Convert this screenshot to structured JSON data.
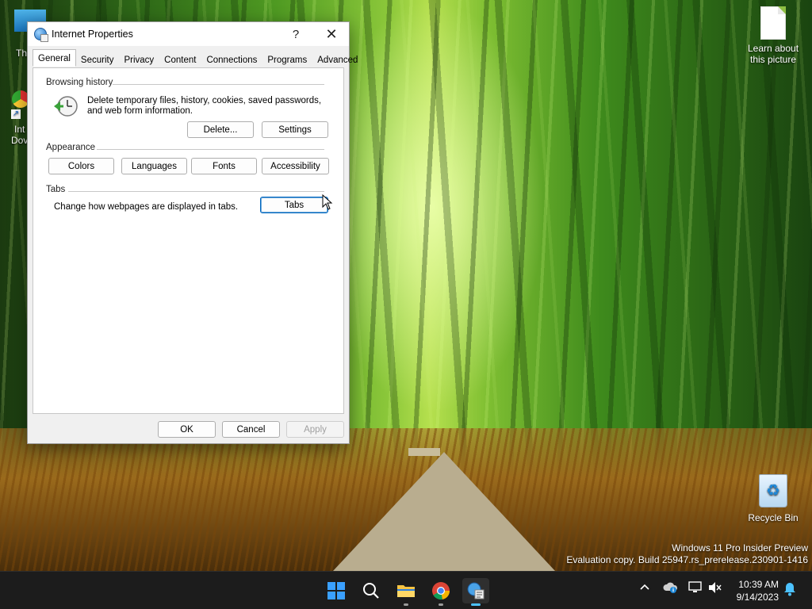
{
  "desktop": {
    "icons": {
      "learn_label": "Learn about this picture",
      "recycle_label": "Recycle Bin",
      "left_top_label": "Th",
      "left_mid_label_1": "Int",
      "left_mid_label_2": "Dov"
    },
    "watermark": {
      "line1": "Windows 11 Pro Insider Preview",
      "line2": "Evaluation copy. Build 25947.rs_prerelease.230901-1416"
    }
  },
  "dialog": {
    "title": "Internet Properties",
    "help_glyph": "?",
    "close_glyph": "✕",
    "tabs": [
      {
        "label": "General"
      },
      {
        "label": "Security"
      },
      {
        "label": "Privacy"
      },
      {
        "label": "Content"
      },
      {
        "label": "Connections"
      },
      {
        "label": "Programs"
      },
      {
        "label": "Advanced"
      }
    ],
    "active_tab": "General",
    "browsing_history": {
      "heading": "Browsing history",
      "description_1": "Delete temporary files, history, cookies, saved passwords,",
      "description_2": "and web form information.",
      "delete_label": "Delete...",
      "settings_label": "Settings"
    },
    "appearance": {
      "heading": "Appearance",
      "colors_label": "Colors",
      "languages_label": "Languages",
      "fonts_label": "Fonts",
      "accessibility_label": "Accessibility"
    },
    "tabs_group": {
      "heading": "Tabs",
      "description": "Change how webpages are displayed in tabs.",
      "tabs_label": "Tabs"
    },
    "footer": {
      "ok_label": "OK",
      "cancel_label": "Cancel",
      "apply_label": "Apply"
    }
  },
  "taskbar": {
    "items": [
      {
        "name": "start-icon"
      },
      {
        "name": "search-icon"
      },
      {
        "name": "file-explorer-icon"
      },
      {
        "name": "chrome-icon"
      },
      {
        "name": "internet-properties-icon"
      }
    ],
    "tray": {
      "chevron": "^"
    },
    "clock": {
      "time": "10:39 AM",
      "date": "9/14/2023"
    }
  },
  "colors": {
    "accent": "#0067c0",
    "taskbar": "#1c1c1c",
    "dialog_bg": "#f0f0f0"
  }
}
